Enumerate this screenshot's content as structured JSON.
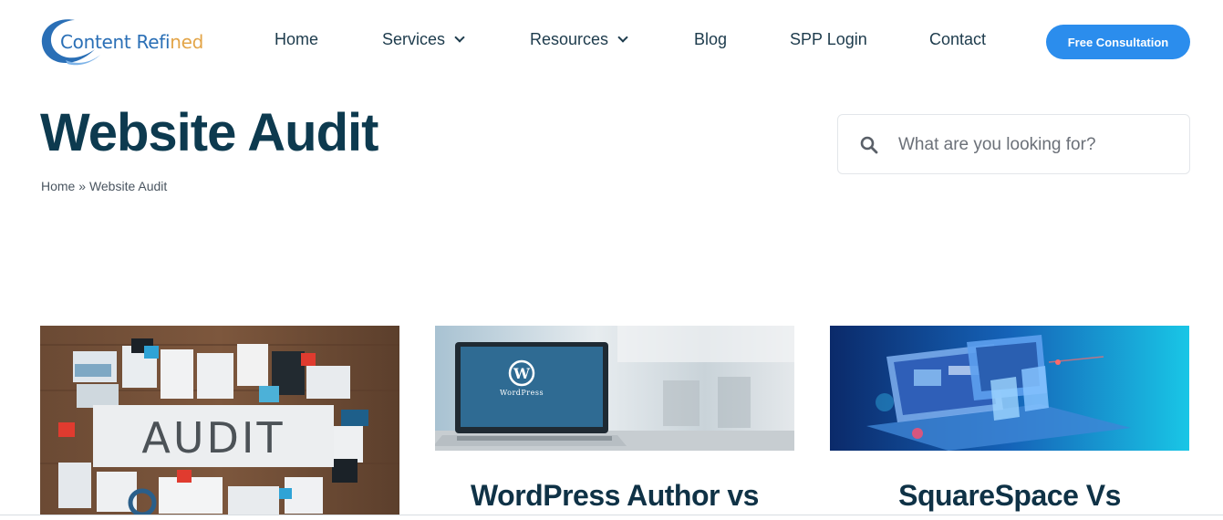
{
  "header": {
    "logo": {
      "part1": "Content ",
      "part2": "Refi",
      "part3": "ned",
      "colors": {
        "primary": "#2a6fb6",
        "accent": "#e3a548"
      }
    },
    "nav": [
      {
        "label": "Home",
        "has_dropdown": false
      },
      {
        "label": "Services",
        "has_dropdown": true
      },
      {
        "label": "Resources",
        "has_dropdown": true
      },
      {
        "label": "Blog",
        "has_dropdown": false
      },
      {
        "label": "SPP Login",
        "has_dropdown": false
      },
      {
        "label": "Contact",
        "has_dropdown": false
      }
    ],
    "cta_label": "Free Consultation",
    "cta_color": "#2b8ded"
  },
  "page": {
    "title": "Website Audit",
    "breadcrumb": {
      "home": "Home",
      "separator": " » ",
      "current": "Website Audit"
    }
  },
  "search": {
    "placeholder": "What are you looking for?",
    "icon": "search-icon"
  },
  "cards": [
    {
      "title": "",
      "image": "audit-documents-image",
      "image_text": "AUDIT"
    },
    {
      "title": "WordPress Author vs",
      "image": "wordpress-laptop-image",
      "image_text": "WordPress"
    },
    {
      "title": "SquareSpace Vs",
      "image": "web-design-devices-image"
    }
  ]
}
